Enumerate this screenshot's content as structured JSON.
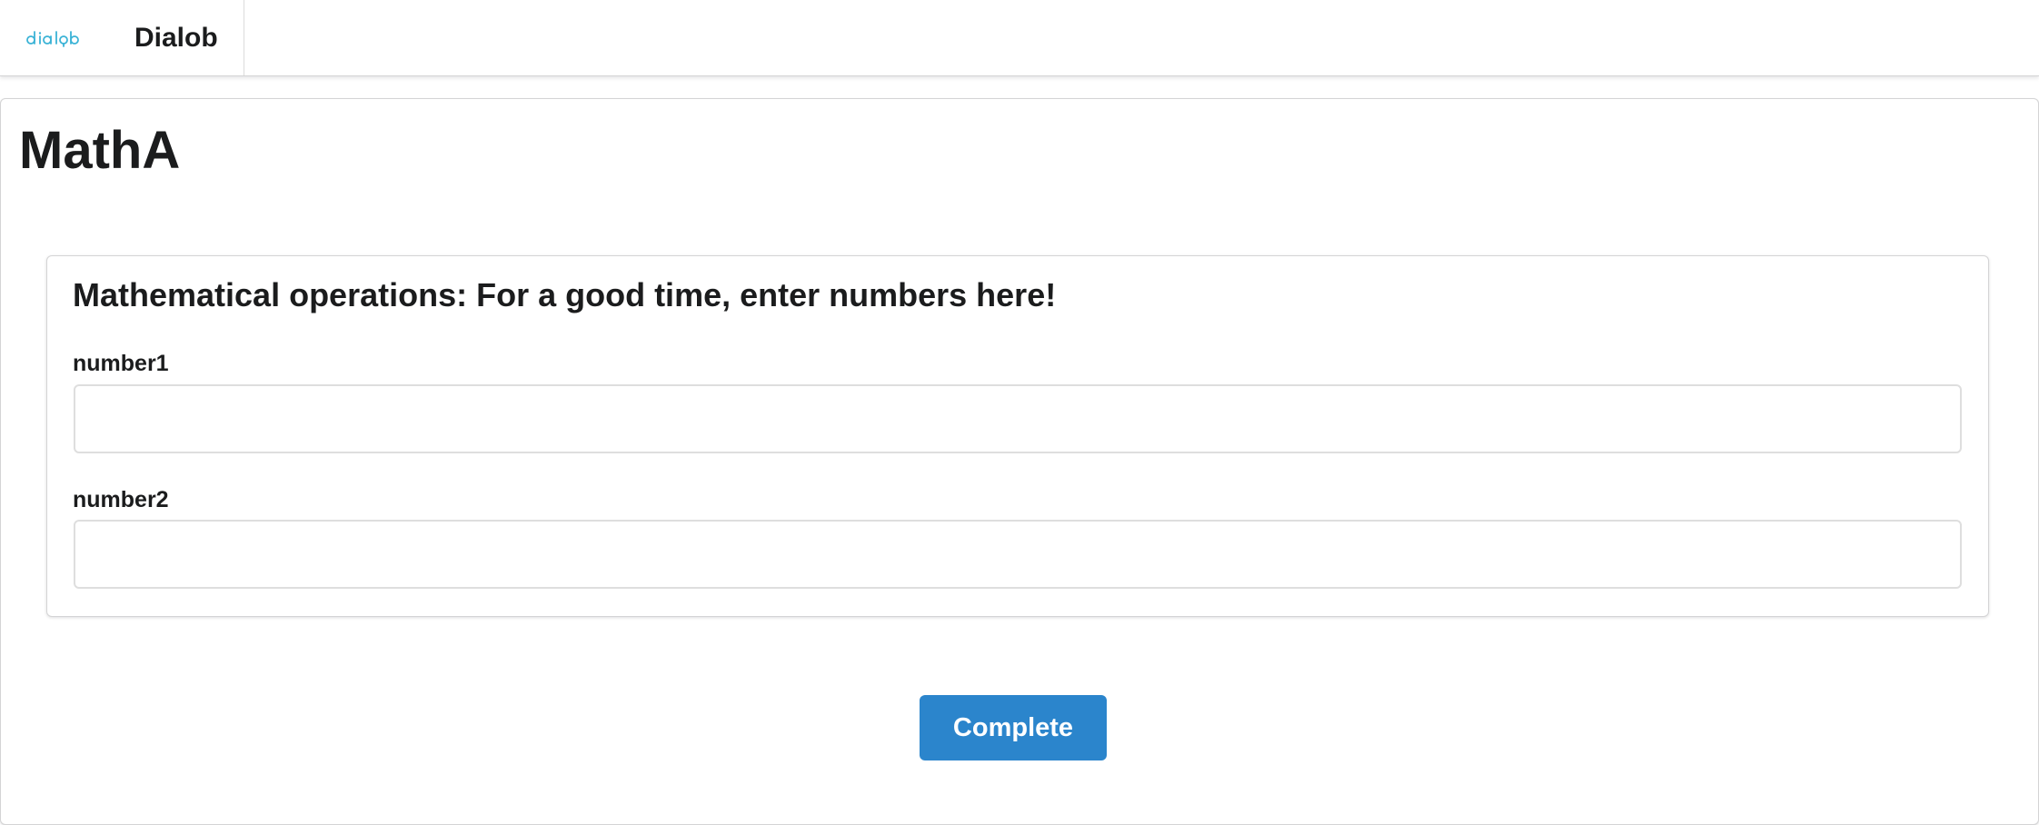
{
  "header": {
    "logo_text": "dialob",
    "brand_name": "Dialob"
  },
  "page": {
    "title": "MathA"
  },
  "group": {
    "title": "Mathematical operations: For a good time, enter numbers here!",
    "fields": [
      {
        "label": "number1",
        "value": "",
        "placeholder": ""
      },
      {
        "label": "number2",
        "value": "",
        "placeholder": ""
      }
    ]
  },
  "actions": {
    "complete_label": "Complete"
  },
  "colors": {
    "accent": "#2b85cc",
    "logo": "#3bb3d6",
    "text": "#1b1c1d",
    "border": "#d4d4d5"
  }
}
